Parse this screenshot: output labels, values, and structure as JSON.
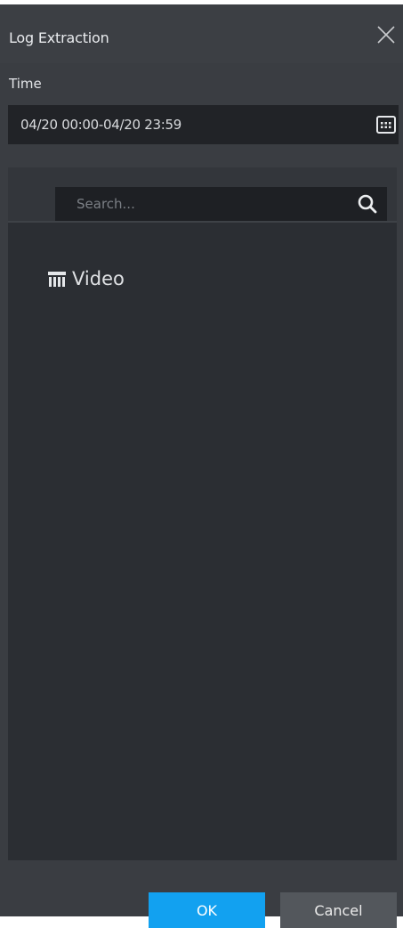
{
  "dialog": {
    "title": "Log Extraction",
    "close_icon": "close-icon"
  },
  "time": {
    "label": "Time",
    "value": "04/20 00:00-04/20 23:59",
    "calendar_icon": "calendar-icon"
  },
  "search": {
    "placeholder": "Search...",
    "icon": "search-icon"
  },
  "tree": {
    "items": [
      {
        "label": "Video",
        "icon": "video-device-icon"
      }
    ]
  },
  "footer": {
    "ok_label": "OK",
    "cancel_label": "Cancel"
  },
  "colors": {
    "primary": "#12a1f0",
    "background": "#3a3d42",
    "panel": "#2b2e33",
    "field": "#212327"
  }
}
